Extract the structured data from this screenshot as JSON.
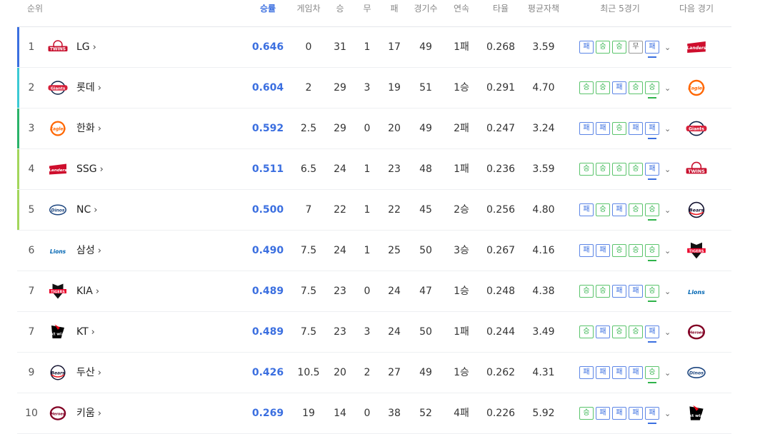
{
  "header": {
    "rank": "순위",
    "pct": "승률",
    "gb": "게임차",
    "w": "승",
    "d": "무",
    "l": "패",
    "g": "경기수",
    "streak": "연속",
    "avg": "타율",
    "era": "평균자책",
    "recent": "최근 5경기",
    "next": "다음 경기"
  },
  "result_labels": {
    "W": "승",
    "L": "패",
    "D": "무"
  },
  "colors": {
    "accent": "#3b6fe0",
    "win": "#2fb34a",
    "loss": "#3b6fe0",
    "draw": "#888888"
  },
  "rows": [
    {
      "rank": "1",
      "team": "LG",
      "logo": "twins-logo",
      "pct": "0.646",
      "gb": "0",
      "w": "31",
      "d": "1",
      "l": "17",
      "g": "49",
      "streak": "1패",
      "avg": "0.268",
      "era": "3.59",
      "recent": [
        "L",
        "W",
        "W",
        "D",
        "L"
      ],
      "next": "landers-logo",
      "bar": "#3b6fe0"
    },
    {
      "rank": "2",
      "team": "롯데",
      "logo": "giants-logo",
      "pct": "0.604",
      "gb": "2",
      "w": "29",
      "d": "3",
      "l": "19",
      "g": "51",
      "streak": "1승",
      "avg": "0.291",
      "era": "4.70",
      "recent": [
        "W",
        "W",
        "L",
        "W",
        "W"
      ],
      "next": "eagles-logo",
      "bar": "#3cc9d4"
    },
    {
      "rank": "3",
      "team": "한화",
      "logo": "eagles-logo",
      "pct": "0.592",
      "gb": "2.5",
      "w": "29",
      "d": "0",
      "l": "20",
      "g": "49",
      "streak": "2패",
      "avg": "0.247",
      "era": "3.24",
      "recent": [
        "L",
        "L",
        "W",
        "L",
        "L"
      ],
      "next": "giants-logo",
      "bar": "#2ab36a"
    },
    {
      "rank": "4",
      "team": "SSG",
      "logo": "landers-logo",
      "pct": "0.511",
      "gb": "6.5",
      "w": "24",
      "d": "1",
      "l": "23",
      "g": "48",
      "streak": "1패",
      "avg": "0.236",
      "era": "3.59",
      "recent": [
        "W",
        "W",
        "W",
        "W",
        "L"
      ],
      "next": "twins-logo",
      "bar": "#a3d65c"
    },
    {
      "rank": "5",
      "team": "NC",
      "logo": "dinos-logo",
      "pct": "0.500",
      "gb": "7",
      "w": "22",
      "d": "1",
      "l": "22",
      "g": "45",
      "streak": "2승",
      "avg": "0.256",
      "era": "4.80",
      "recent": [
        "L",
        "W",
        "L",
        "W",
        "W"
      ],
      "next": "bears-logo",
      "bar": "#a3d65c"
    },
    {
      "rank": "6",
      "team": "삼성",
      "logo": "lions-logo",
      "pct": "0.490",
      "gb": "7.5",
      "w": "24",
      "d": "1",
      "l": "25",
      "g": "50",
      "streak": "3승",
      "avg": "0.267",
      "era": "4.16",
      "recent": [
        "L",
        "L",
        "W",
        "W",
        "W"
      ],
      "next": "tigers-logo",
      "bar": ""
    },
    {
      "rank": "7",
      "team": "KIA",
      "logo": "tigers-logo",
      "pct": "0.489",
      "gb": "7.5",
      "w": "23",
      "d": "0",
      "l": "24",
      "g": "47",
      "streak": "1승",
      "avg": "0.248",
      "era": "4.38",
      "recent": [
        "W",
        "W",
        "L",
        "L",
        "W"
      ],
      "next": "lions-logo",
      "bar": ""
    },
    {
      "rank": "7",
      "team": "KT",
      "logo": "ktwiz-logo",
      "pct": "0.489",
      "gb": "7.5",
      "w": "23",
      "d": "3",
      "l": "24",
      "g": "50",
      "streak": "1패",
      "avg": "0.244",
      "era": "3.49",
      "recent": [
        "W",
        "L",
        "W",
        "W",
        "L"
      ],
      "next": "heroes-logo",
      "bar": ""
    },
    {
      "rank": "9",
      "team": "두산",
      "logo": "bears-logo",
      "pct": "0.426",
      "gb": "10.5",
      "w": "20",
      "d": "2",
      "l": "27",
      "g": "49",
      "streak": "1승",
      "avg": "0.262",
      "era": "4.31",
      "recent": [
        "L",
        "L",
        "L",
        "L",
        "W"
      ],
      "next": "dinos-logo",
      "bar": ""
    },
    {
      "rank": "10",
      "team": "키움",
      "logo": "heroes-logo",
      "pct": "0.269",
      "gb": "19",
      "w": "14",
      "d": "0",
      "l": "38",
      "g": "52",
      "streak": "4패",
      "avg": "0.226",
      "era": "5.92",
      "recent": [
        "W",
        "L",
        "L",
        "L",
        "L"
      ],
      "next": "ktwiz-logo",
      "bar": ""
    }
  ]
}
